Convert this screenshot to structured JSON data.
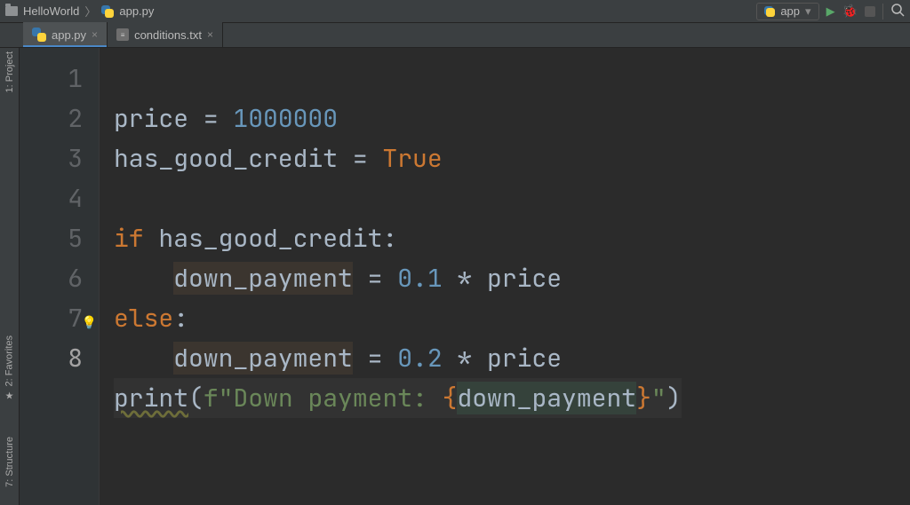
{
  "breadcrumb": {
    "project": "HelloWorld",
    "file": "app.py"
  },
  "run": {
    "config": "app"
  },
  "tabs": [
    {
      "label": "app.py",
      "icon": "python",
      "active": true
    },
    {
      "label": "conditions.txt",
      "icon": "txt",
      "active": false
    }
  ],
  "tool_tabs": {
    "project": "1: Project",
    "favorites": "2: Favorites",
    "structure": "7: Structure"
  },
  "gutter": {
    "line_numbers": [
      "1",
      "2",
      "3",
      "4",
      "5",
      "6",
      "7",
      "8"
    ],
    "current_line": 8,
    "hint_line": 7
  },
  "code": {
    "l1_var": "price",
    "l1_eq": " = ",
    "l1_num": "1000000",
    "l2_var": "has_good_credit",
    "l2_eq": " = ",
    "l2_true": "True",
    "l4_if": "if ",
    "l4_cond": "has_good_credit",
    "l4_colon": ":",
    "l5_indent": "    ",
    "l5_var": "down_payment",
    "l5_eq": " = ",
    "l5_n": "0.1",
    "l5_op": " * ",
    "l5_p": "price",
    "l6_else": "else",
    "l6_colon": ":",
    "l7_indent": "    ",
    "l7_var": "down_payment",
    "l7_eq": " = ",
    "l7_n": "0.2",
    "l7_op": " * ",
    "l7_p": "price",
    "l8_fn": "print",
    "l8_open": "(",
    "l8_f": "f\"",
    "l8_s1": "Down payment: ",
    "l8_lb": "{",
    "l8_fvar": "down_payment",
    "l8_rb": "}",
    "l8_s2": "\"",
    "l8_close": ")"
  }
}
